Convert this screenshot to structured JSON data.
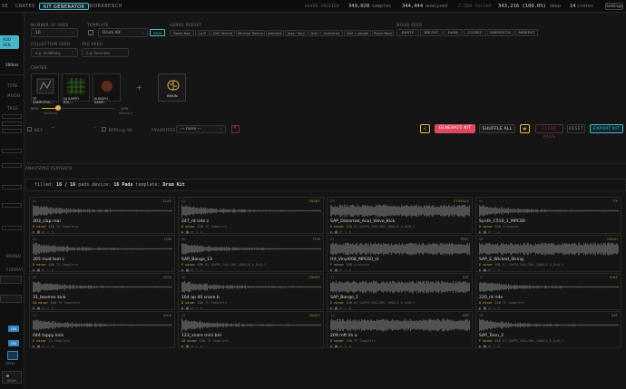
{
  "nav": {
    "tabs": [
      "SE",
      "CRATES",
      "KIT GENERATOR",
      "WORKBENCH"
    ],
    "active_index": 2
  },
  "header_stats": {
    "mode": "HOVER PREVIEW",
    "samples_count": "349,028",
    "samples_label": "samples",
    "analyzed_count": "344,444",
    "analyzed_label": "analyzed",
    "failed_count": "2,584",
    "failed_label": "failed",
    "deep_count": "343,216 (100.0%)",
    "deep_label": "deep",
    "crates_count": "14",
    "crates_label": "crates",
    "settings_label": "Settings"
  },
  "sidebar": {
    "accent_label": "ADD",
    "accent_sub": "GEN",
    "duration": "200ms",
    "labels": [
      "TYPE",
      "MOOD",
      "TAGS",
      "BRAND",
      "FORMAT"
    ],
    "toggle_labels": [
      "ON",
      "ON"
    ],
    "apply_label": "APPLY",
    "slider_label": "Slider"
  },
  "generator": {
    "num_pads_label": "NUMBER OF PADS",
    "num_pads_value": "16",
    "template_label": "TEMPLATE",
    "template_value": "Drum Kit",
    "save_label": "SAVE",
    "genre_label": "GENRE PRESET",
    "genres": [
      "Boom Bap",
      "Lo-Fi",
      "Drill Techno",
      "Minimal Techno",
      "Ambient",
      "Jazz / Soul",
      "Dub",
      "Industrial",
      "Drill + Jungle",
      "Psych Rock"
    ],
    "mood_label": "MOOD SEED",
    "moods": [
      "DUSTY",
      "BRIGHT",
      "DARK",
      "COSMIC",
      "ENERGETIC",
      "AMBIENT"
    ],
    "collection_label": "COLLECTION SEED",
    "collection_placeholder": "e.g. Goldbaby",
    "tag_label": "TAG SEED",
    "tag_placeholder": "e.g. favorites"
  },
  "crates": {
    "label": "CRATES",
    "items": [
      "TE SAMPLERS...",
      "DJ SAPPO ROL...",
      "KUNGFU SAMP..."
    ],
    "add_label": "+",
    "brain_label": "BRAIN",
    "slider_left": "90%",
    "slider_right": "10%",
    "slider_left_sub": "Similarity",
    "slider_right_sub": "Wildcard"
  },
  "controls": {
    "key_label": "KEY",
    "key_value": "—",
    "bpm_label": "BPM",
    "bpm_placeholder": "e.g. 90",
    "favorites_label": "FAVORITES",
    "favorites_value": "— none —",
    "back_label": "<",
    "generate_label": "GENERATE KIT",
    "shuffle_label": "SHUFFLE ALL",
    "star_label": "★",
    "clear_label": "CLEAR PADS",
    "reset_label": "RESET",
    "export_label": "EXPORT KIT"
  },
  "playback": {
    "section_label": "ANALYZING PLAYBACK",
    "filled_label": "filled:",
    "filled_value": "16 / 16",
    "pads_label": "pads",
    "device_label": "device:",
    "device_value": "16 Pads",
    "template_label": "template:",
    "template_value": "Drum Kit"
  },
  "pads": [
    {
      "num": "01",
      "tag": "CLAP",
      "name": "303_clap real",
      "key": "D minor",
      "bpm": "116",
      "source": "TE Samplers"
    },
    {
      "num": "02",
      "tag": "SNARE",
      "name": "247_nt ride z",
      "key": "D minor",
      "bpm": "128",
      "source": "TE Samplers"
    },
    {
      "num": "03",
      "tag": "CYMBALS",
      "name": "SAP_Distorted_Anal_Valve_Kick",
      "key": "D minor",
      "bpm": "128",
      "source": "DJ_SAPPO_ROLLING_JUNGLE_&_DnB-1"
    },
    {
      "num": "04",
      "tag": "FX",
      "name": "Synth_C510_1_MPC60",
      "key": "D minor",
      "bpm": "128",
      "source": "Grimeyda"
    },
    {
      "num": "05",
      "tag": "TOM",
      "name": "305 mud tom c",
      "key": "D minor",
      "bpm": "126",
      "source": "TE Samplers"
    },
    {
      "num": "06",
      "tag": "TOM",
      "name": "SAP_Bongo_13",
      "key": "E minor",
      "bpm": "126",
      "source": "DJ_SAPPO_ROLLING_JUNGLE_&_DnB-1"
    },
    {
      "num": "07",
      "tag": "PERC",
      "name": "Hit_Vinyl008_MPC60_st",
      "key": "F minor",
      "bpm": "128",
      "source": "Grimeyda"
    },
    {
      "num": "08",
      "tag": "CRASH",
      "name": "SAP_E_Wicked_String",
      "key": "E minor",
      "bpm": "181",
      "source": "DJ_SAPPO_ROLLING_JUNGLE_&_DnB-1"
    },
    {
      "num": "09",
      "tag": "KICK",
      "name": "31_boomer kick",
      "key": "C# minor",
      "bpm": "116",
      "source": "TE Samplers"
    },
    {
      "num": "10",
      "tag": "SNARE",
      "name": "164 ap 40 snare b",
      "key": "D minor",
      "bpm": "126",
      "source": "TE Samplers"
    },
    {
      "num": "11",
      "tag": "HAT",
      "name": "SAP_Bongo_1",
      "key": "E minor",
      "bpm": "128",
      "source": "DJ_SAPPO_ROLLING_JUNGLE_&_DnB-1"
    },
    {
      "num": "12",
      "tag": "RIDE",
      "name": "220_nt ride",
      "key": "D minor",
      "bpm": "128",
      "source": "TE Samplers"
    },
    {
      "num": "13",
      "tag": "KICK",
      "name": "044 tappy kick",
      "key": "E minor",
      "bpm": "",
      "source": "TE Samplers"
    },
    {
      "num": "14",
      "tag": "SNARE",
      "name": "123_snare mini bm",
      "key": "C# minor",
      "bpm": "126",
      "source": "TE Samplers"
    },
    {
      "num": "15",
      "tag": "HAT",
      "name": "209 mft hh a",
      "key": "D minor",
      "bpm": "128",
      "source": "TE Samplers"
    },
    {
      "num": "16",
      "tag": "HAT",
      "name": "SAP_Toon_2",
      "key": "F minor",
      "bpm": "128",
      "source": "DJ_SAPPO_ROLLING_JUNGLE_&_DnB-1"
    }
  ],
  "colors": {
    "accent_teal": "#48b6c8",
    "generate_red": "#e0475f",
    "key_gold": "#d4a243",
    "star_yellow": "#e5c143"
  }
}
